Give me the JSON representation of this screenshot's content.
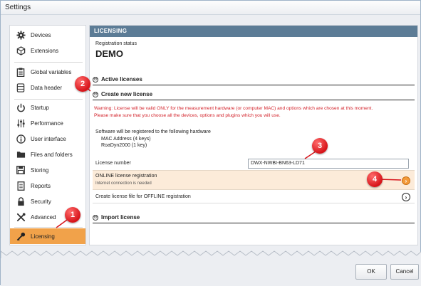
{
  "window": {
    "title": "Settings"
  },
  "sidebar": {
    "items": [
      {
        "label": "Devices",
        "icon": "gear-icon"
      },
      {
        "label": "Extensions",
        "icon": "puzzle-icon"
      },
      {
        "label": "Global variables",
        "icon": "clipboard-icon"
      },
      {
        "label": "Data header",
        "icon": "database-icon"
      },
      {
        "label": "Startup",
        "icon": "power-icon"
      },
      {
        "label": "Performance",
        "icon": "sliders-icon"
      },
      {
        "label": "User interface",
        "icon": "info-icon"
      },
      {
        "label": "Files and folders",
        "icon": "folder-icon"
      },
      {
        "label": "Storing",
        "icon": "save-icon"
      },
      {
        "label": "Reports",
        "icon": "report-icon"
      },
      {
        "label": "Security",
        "icon": "lock-icon"
      },
      {
        "label": "Advanced",
        "icon": "tools-icon"
      },
      {
        "label": "Licensing",
        "icon": "key-icon",
        "selected": true
      }
    ]
  },
  "content": {
    "header": "LICENSING",
    "registration_status_label": "Registration status",
    "registration_status_value": "DEMO",
    "active_licenses": "Active licenses",
    "create_new_license": "Create new license",
    "warning_line1": "Warning: License will be valid ONLY for the measurement hardware (or computer MAC) and options which are chosen at this moment.",
    "warning_line2": "Please make sure that you choose all the devices, options and plugins which you will use.",
    "hardware_intro": "Software will be registered to the following hardware",
    "hardware_items": [
      "MAC Address (4 keys)",
      "RoaDyn2000 (1 key)"
    ],
    "license_number_label": "License number",
    "license_number_value": "DWX-NWBI-BN63-LD71",
    "online_title": "ONLINE license registration",
    "online_sub": "Internet connection is needed",
    "offline_title": "Create license file for OFFLINE registration",
    "import_license": "Import license"
  },
  "markers": [
    "1",
    "2",
    "3",
    "4"
  ],
  "footer": {
    "ok": "OK",
    "cancel": "Cancel"
  },
  "colors": {
    "accent": "#f1a24a",
    "header": "#5c7c96",
    "warning": "#d3232b",
    "marker": "#d7141a",
    "online_row": "#fcebd9"
  }
}
